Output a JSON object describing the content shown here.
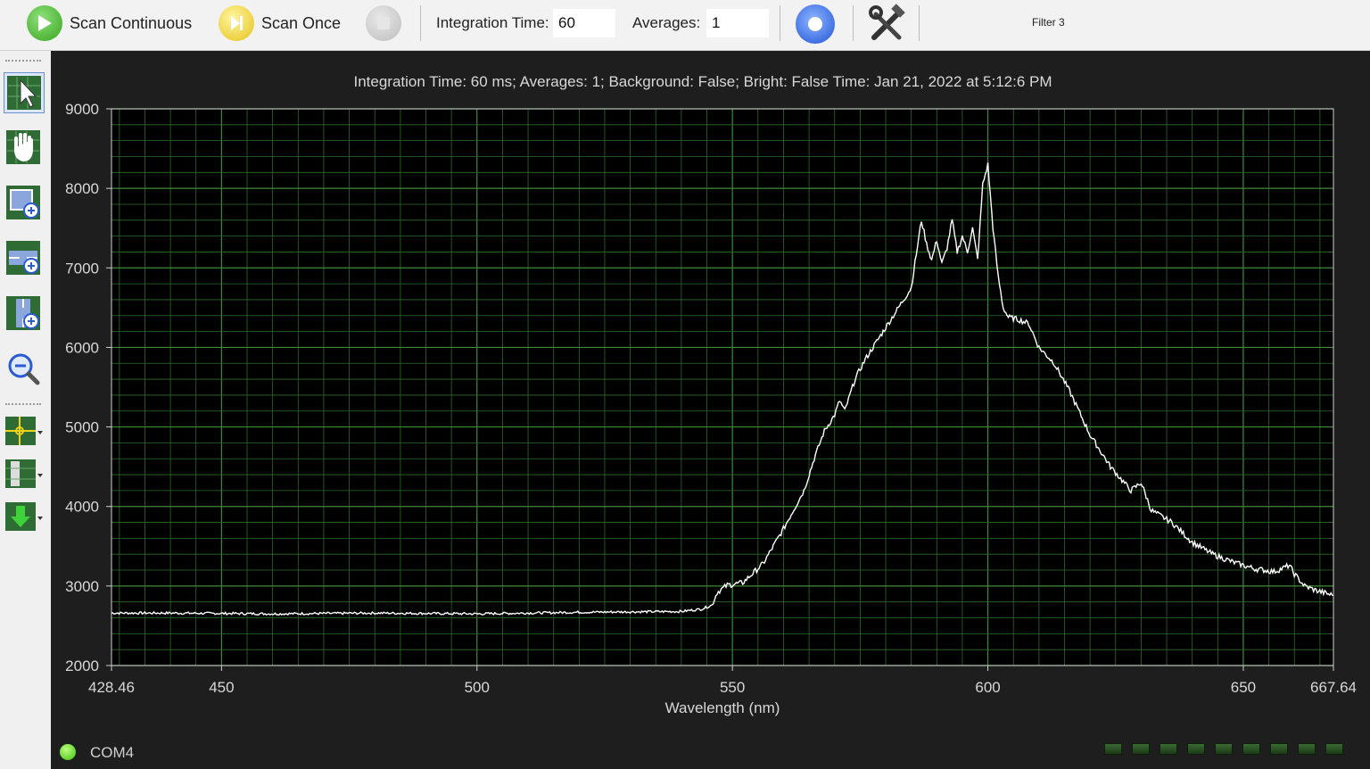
{
  "toolbar": {
    "scan_continuous_label": "Scan Continuous",
    "scan_once_label": "Scan Once",
    "integration_time_label": "Integration Time:",
    "integration_time_value": "60",
    "averages_label": "Averages:",
    "averages_value": "1",
    "filter_label": "Filter 3"
  },
  "left_tools": [
    "pointer-icon",
    "pan-hand-icon",
    "zoom-box-icon",
    "zoom-horizontal-icon",
    "zoom-vertical-icon",
    "zoom-out-icon",
    "crosshair-icon",
    "marker-icon",
    "download-icon"
  ],
  "chart_header": "Integration Time: 60 ms; Averages: 1; Background: False; Bright: False Time: Jan 21, 2022 at 5:12:6 PM",
  "status": {
    "port": "COM4"
  },
  "colors": {
    "plot_bg": "#000000",
    "grid": "#2f6b2a",
    "trace": "#ffffff",
    "app_bg": "#1e1e1e"
  },
  "chart_data": {
    "type": "line",
    "title": "Integration Time: 60 ms; Averages: 1; Background: False; Bright: False Time: Jan 21, 2022 at 5:12:6 PM",
    "xlabel": "Wavelength (nm)",
    "ylabel": "",
    "xlim": [
      428.46,
      667.64
    ],
    "ylim": [
      2000,
      9000
    ],
    "x_ticks": [
      "428.46",
      "450",
      "500",
      "550",
      "600",
      "650",
      "667.64"
    ],
    "y_ticks": [
      "9000",
      "8000",
      "7000",
      "6000",
      "5000",
      "4000",
      "3000",
      "2000"
    ],
    "grid": true,
    "series": [
      {
        "x": [
          428.46,
          440,
          460,
          480,
          500,
          520,
          540,
          544,
          546,
          547,
          549,
          552,
          556,
          560,
          564,
          566,
          568,
          570,
          571,
          572,
          574,
          576,
          579,
          582,
          585,
          587,
          588,
          589,
          590,
          591,
          592,
          593,
          594,
          595,
          596,
          597,
          598,
          599,
          600,
          601,
          602,
          603,
          604,
          606,
          608,
          610,
          613,
          616,
          620,
          624,
          628,
          630,
          632,
          636,
          640,
          644,
          648,
          652,
          656,
          658,
          659,
          660,
          662,
          664,
          667.64
        ],
        "y": [
          2660,
          2660,
          2650,
          2660,
          2650,
          2670,
          2680,
          2710,
          2760,
          2920,
          3010,
          3040,
          3280,
          3720,
          4200,
          4600,
          4950,
          5150,
          5330,
          5200,
          5600,
          5850,
          6150,
          6450,
          6750,
          7600,
          7300,
          7100,
          7350,
          7050,
          7250,
          7600,
          7200,
          7400,
          7200,
          7500,
          7100,
          8050,
          8300,
          7500,
          6900,
          6500,
          6380,
          6350,
          6300,
          6000,
          5800,
          5450,
          4900,
          4500,
          4200,
          4300,
          3950,
          3800,
          3550,
          3400,
          3300,
          3220,
          3180,
          3230,
          3260,
          3150,
          3000,
          2950,
          2880
        ]
      }
    ]
  }
}
